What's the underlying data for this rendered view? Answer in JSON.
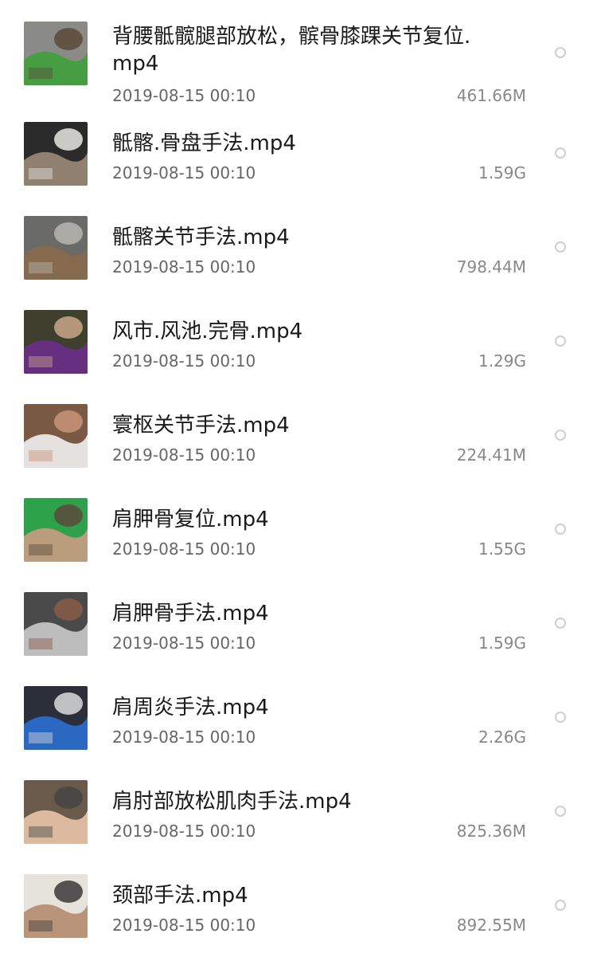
{
  "files": [
    {
      "name": "背腰骶髋腿部放松，髌骨膝踝关节复位.mp4",
      "date": "2019-08-15 00:10",
      "size": "461.66M",
      "thumb_colors": [
        "#8a8a86",
        "#3f9f3a",
        "#5a4a3a"
      ]
    },
    {
      "name": "骶髂.骨盘手法.mp4",
      "date": "2019-08-15 00:10",
      "size": "1.59G",
      "thumb_colors": [
        "#2b2b2b",
        "#9a8a78",
        "#e8e6e2"
      ]
    },
    {
      "name": "骶髂关节手法.mp4",
      "date": "2019-08-15 00:10",
      "size": "798.44M",
      "thumb_colors": [
        "#6a6a66",
        "#8a6a4a",
        "#b7b5b0"
      ]
    },
    {
      "name": "风市.风池.完骨.mp4",
      "date": "2019-08-15 00:10",
      "size": "1.29G",
      "thumb_colors": [
        "#3e3f2c",
        "#6a2e8a",
        "#c9a68a"
      ]
    },
    {
      "name": "寰枢关节手法.mp4",
      "date": "2019-08-15 00:10",
      "size": "224.41M",
      "thumb_colors": [
        "#7a5a42",
        "#efefef",
        "#c8947a"
      ]
    },
    {
      "name": "肩胛骨复位.mp4",
      "date": "2019-08-15 00:10",
      "size": "1.55G",
      "thumb_colors": [
        "#2ea24a",
        "#c99c82",
        "#5b4a3c"
      ]
    },
    {
      "name": "肩胛骨手法.mp4",
      "date": "2019-08-15 00:10",
      "size": "1.59G",
      "thumb_colors": [
        "#4a4a4a",
        "#c9c9c9",
        "#8a5a48"
      ]
    },
    {
      "name": "肩周炎手法.mp4",
      "date": "2019-08-15 00:10",
      "size": "2.26G",
      "thumb_colors": [
        "#2a2f3a",
        "#2a6fd1",
        "#d9d9d9"
      ]
    },
    {
      "name": "肩肘部放松肌肉手法.mp4",
      "date": "2019-08-15 00:10",
      "size": "825.36M",
      "thumb_colors": [
        "#6a5a4a",
        "#e8c4a8",
        "#444444"
      ]
    },
    {
      "name": "颈部手法.mp4",
      "date": "2019-08-15 00:10",
      "size": "892.55M",
      "thumb_colors": [
        "#e6e2dc",
        "#b58c6e",
        "#3a3a3a"
      ]
    }
  ]
}
